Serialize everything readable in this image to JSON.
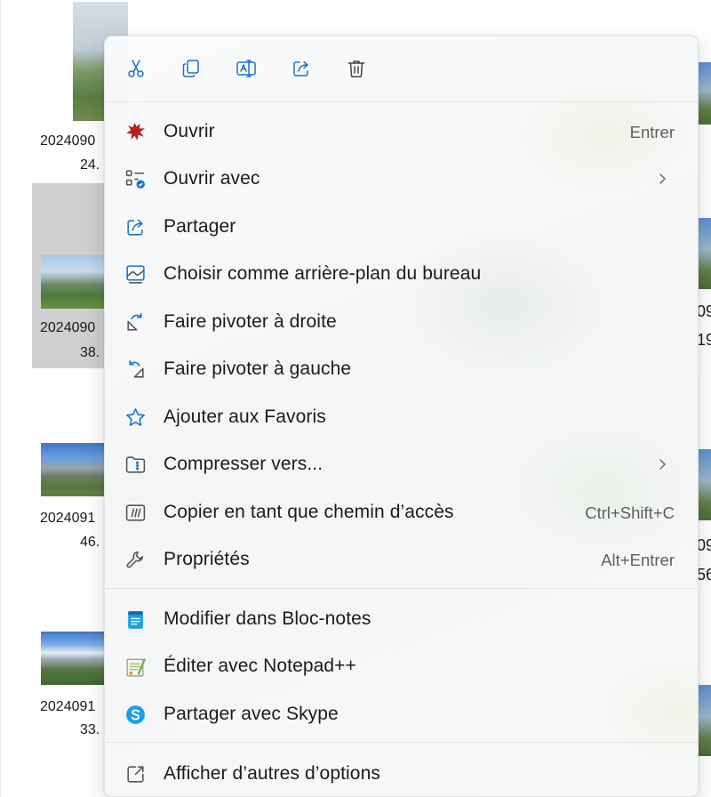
{
  "explorer": {
    "files": [
      {
        "name_line1": "2024090",
        "name_line2": "24."
      },
      {
        "name_line1": "2024090",
        "name_line2": "38."
      },
      {
        "name_line1": "2024091",
        "name_line2": "46."
      },
      {
        "name_line1": "2024091",
        "name_line2": "33."
      }
    ],
    "right_fragments": [
      "09",
      "19",
      "09",
      "56"
    ]
  },
  "context_menu": {
    "toolbar": [
      {
        "icon": "scissors-icon",
        "label": "Couper"
      },
      {
        "icon": "copy-icon",
        "label": "Copier"
      },
      {
        "icon": "rename-icon",
        "label": "Renommer"
      },
      {
        "icon": "share-icon",
        "label": "Partager"
      },
      {
        "icon": "trash-icon",
        "label": "Supprimer"
      }
    ],
    "items": [
      {
        "icon": "paint-splash-icon",
        "label": "Ouvrir",
        "shortcut": "Entrer"
      },
      {
        "icon": "open-with-icon",
        "label": "Ouvrir avec",
        "submenu": true
      },
      {
        "icon": "share-icon",
        "label": "Partager"
      },
      {
        "icon": "wallpaper-icon",
        "label": "Choisir comme arrière-plan du bureau"
      },
      {
        "icon": "rotate-right-icon",
        "label": "Faire pivoter à droite"
      },
      {
        "icon": "rotate-left-icon",
        "label": "Faire pivoter à gauche"
      },
      {
        "icon": "star-icon",
        "label": "Ajouter aux Favoris"
      },
      {
        "icon": "zip-folder-icon",
        "label": "Compresser vers...",
        "submenu": true
      },
      {
        "icon": "copy-path-icon",
        "label": "Copier en tant que chemin d’accès",
        "shortcut": "Ctrl+Shift+C"
      },
      {
        "icon": "wrench-icon",
        "label": "Propriétés",
        "shortcut": "Alt+Entrer"
      },
      {
        "icon": "notepad-icon",
        "label": "Modifier dans Bloc-notes"
      },
      {
        "icon": "notepadpp-icon",
        "label": "Éditer avec Notepad++"
      },
      {
        "icon": "skype-icon",
        "label": "Partager avec Skype"
      },
      {
        "icon": "more-options-icon",
        "label": "Afficher d’autres d’options"
      }
    ]
  },
  "colors": {
    "accent": "#1a73c8",
    "text": "#1b1b1b",
    "shortcut": "#5f5f5f"
  }
}
